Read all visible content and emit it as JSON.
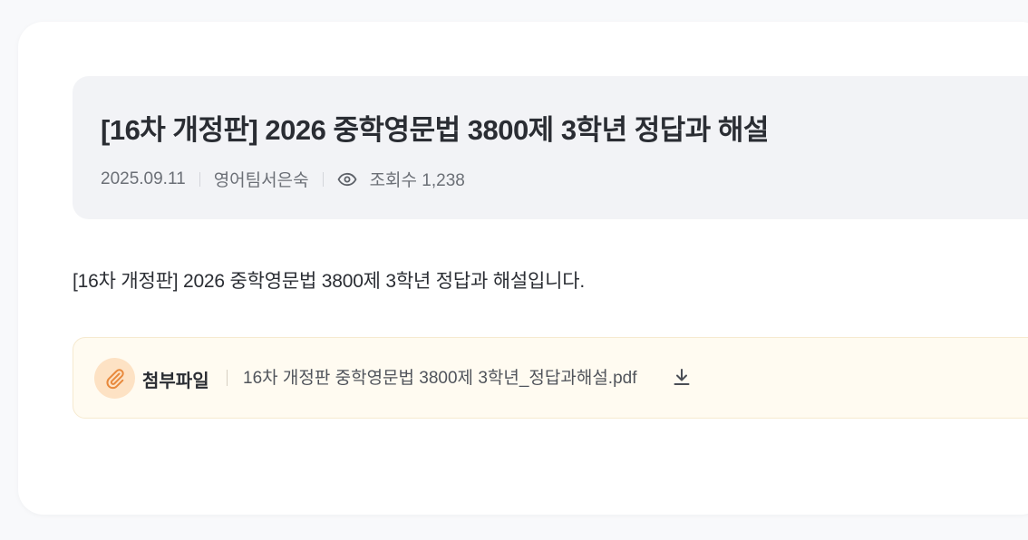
{
  "post": {
    "title": "[16차 개정판] 2026 중학영문법 3800제 3학년 정답과 해설",
    "date": "2025.09.11",
    "author": "영어팀서은숙",
    "views_label": "조회수 1,238",
    "body": "[16차 개정판] 2026 중학영문법 3800제 3학년 정답과 해설입니다."
  },
  "attachment": {
    "label": "첨부파일",
    "file_name": "16차 개정판 중학영문법 3800제 3학년_정답과해설.pdf",
    "icon": "paperclip-icon",
    "download_icon": "download-icon"
  },
  "colors": {
    "accent": "#e8893c",
    "attachment_bg": "#fffbf1",
    "header_bg": "#f2f3f6"
  }
}
